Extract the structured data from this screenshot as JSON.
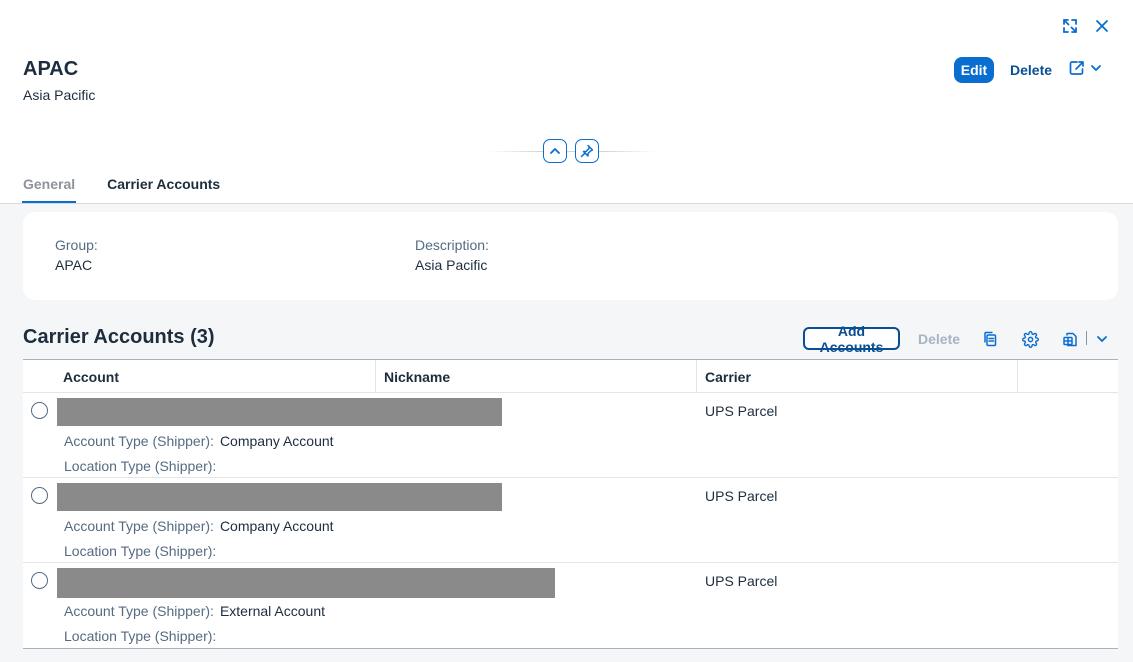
{
  "header": {
    "title": "APAC",
    "subtitle": "Asia Pacific",
    "edit_label": "Edit",
    "delete_label": "Delete",
    "icons": [
      "expand-icon",
      "close-icon",
      "share-icon",
      "chevron-down-icon",
      "collapse-header-icon",
      "pin-icon"
    ]
  },
  "tabs": [
    {
      "label": "General",
      "selected": true
    },
    {
      "label": "Carrier Accounts",
      "selected": false
    }
  ],
  "general": {
    "group_label": "Group:",
    "group_value": "APAC",
    "description_label": "Description:",
    "description_value": "Asia Pacific"
  },
  "carrier_accounts": {
    "title": "Carrier Accounts (3)",
    "add_label": "Add Accounts",
    "delete_label": "Delete",
    "columns": [
      "Account",
      "Nickname",
      "Carrier"
    ],
    "rows": [
      {
        "carrier": "UPS Parcel",
        "account_type_label": "Account Type (Shipper):",
        "account_type": "Company Account",
        "location_type_label": "Location Type (Shipper):",
        "location_type": ""
      },
      {
        "carrier": "UPS Parcel",
        "account_type_label": "Account Type (Shipper):",
        "account_type": "Company Account",
        "location_type_label": "Location Type (Shipper):",
        "location_type": ""
      },
      {
        "carrier": "UPS Parcel",
        "account_type_label": "Account Type (Shipper):",
        "account_type": "External Account",
        "location_type_label": "Location Type (Shipper):",
        "location_type": ""
      }
    ]
  },
  "colors": {
    "accent": "#0a6ed1",
    "text": "#1d2d3e",
    "label": "#556b82",
    "background": "#f5f6f7",
    "redacted": "#8a8a8a"
  }
}
